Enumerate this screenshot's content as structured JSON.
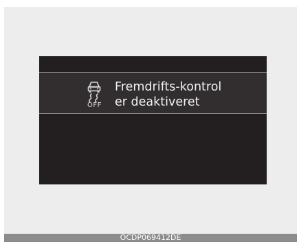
{
  "display": {
    "message_line1": "Fremdrifts-kontrol",
    "message_line2": "er deaktiveret",
    "icon": "traction-control-off-icon",
    "icon_label": "OFF"
  },
  "caption": "OCDP069412DE",
  "colors": {
    "screen": "#231f20",
    "band": "#322e2f",
    "text": "#f2f2f2",
    "frame": "#ededed",
    "caption_bar": "#8c8c8c"
  }
}
